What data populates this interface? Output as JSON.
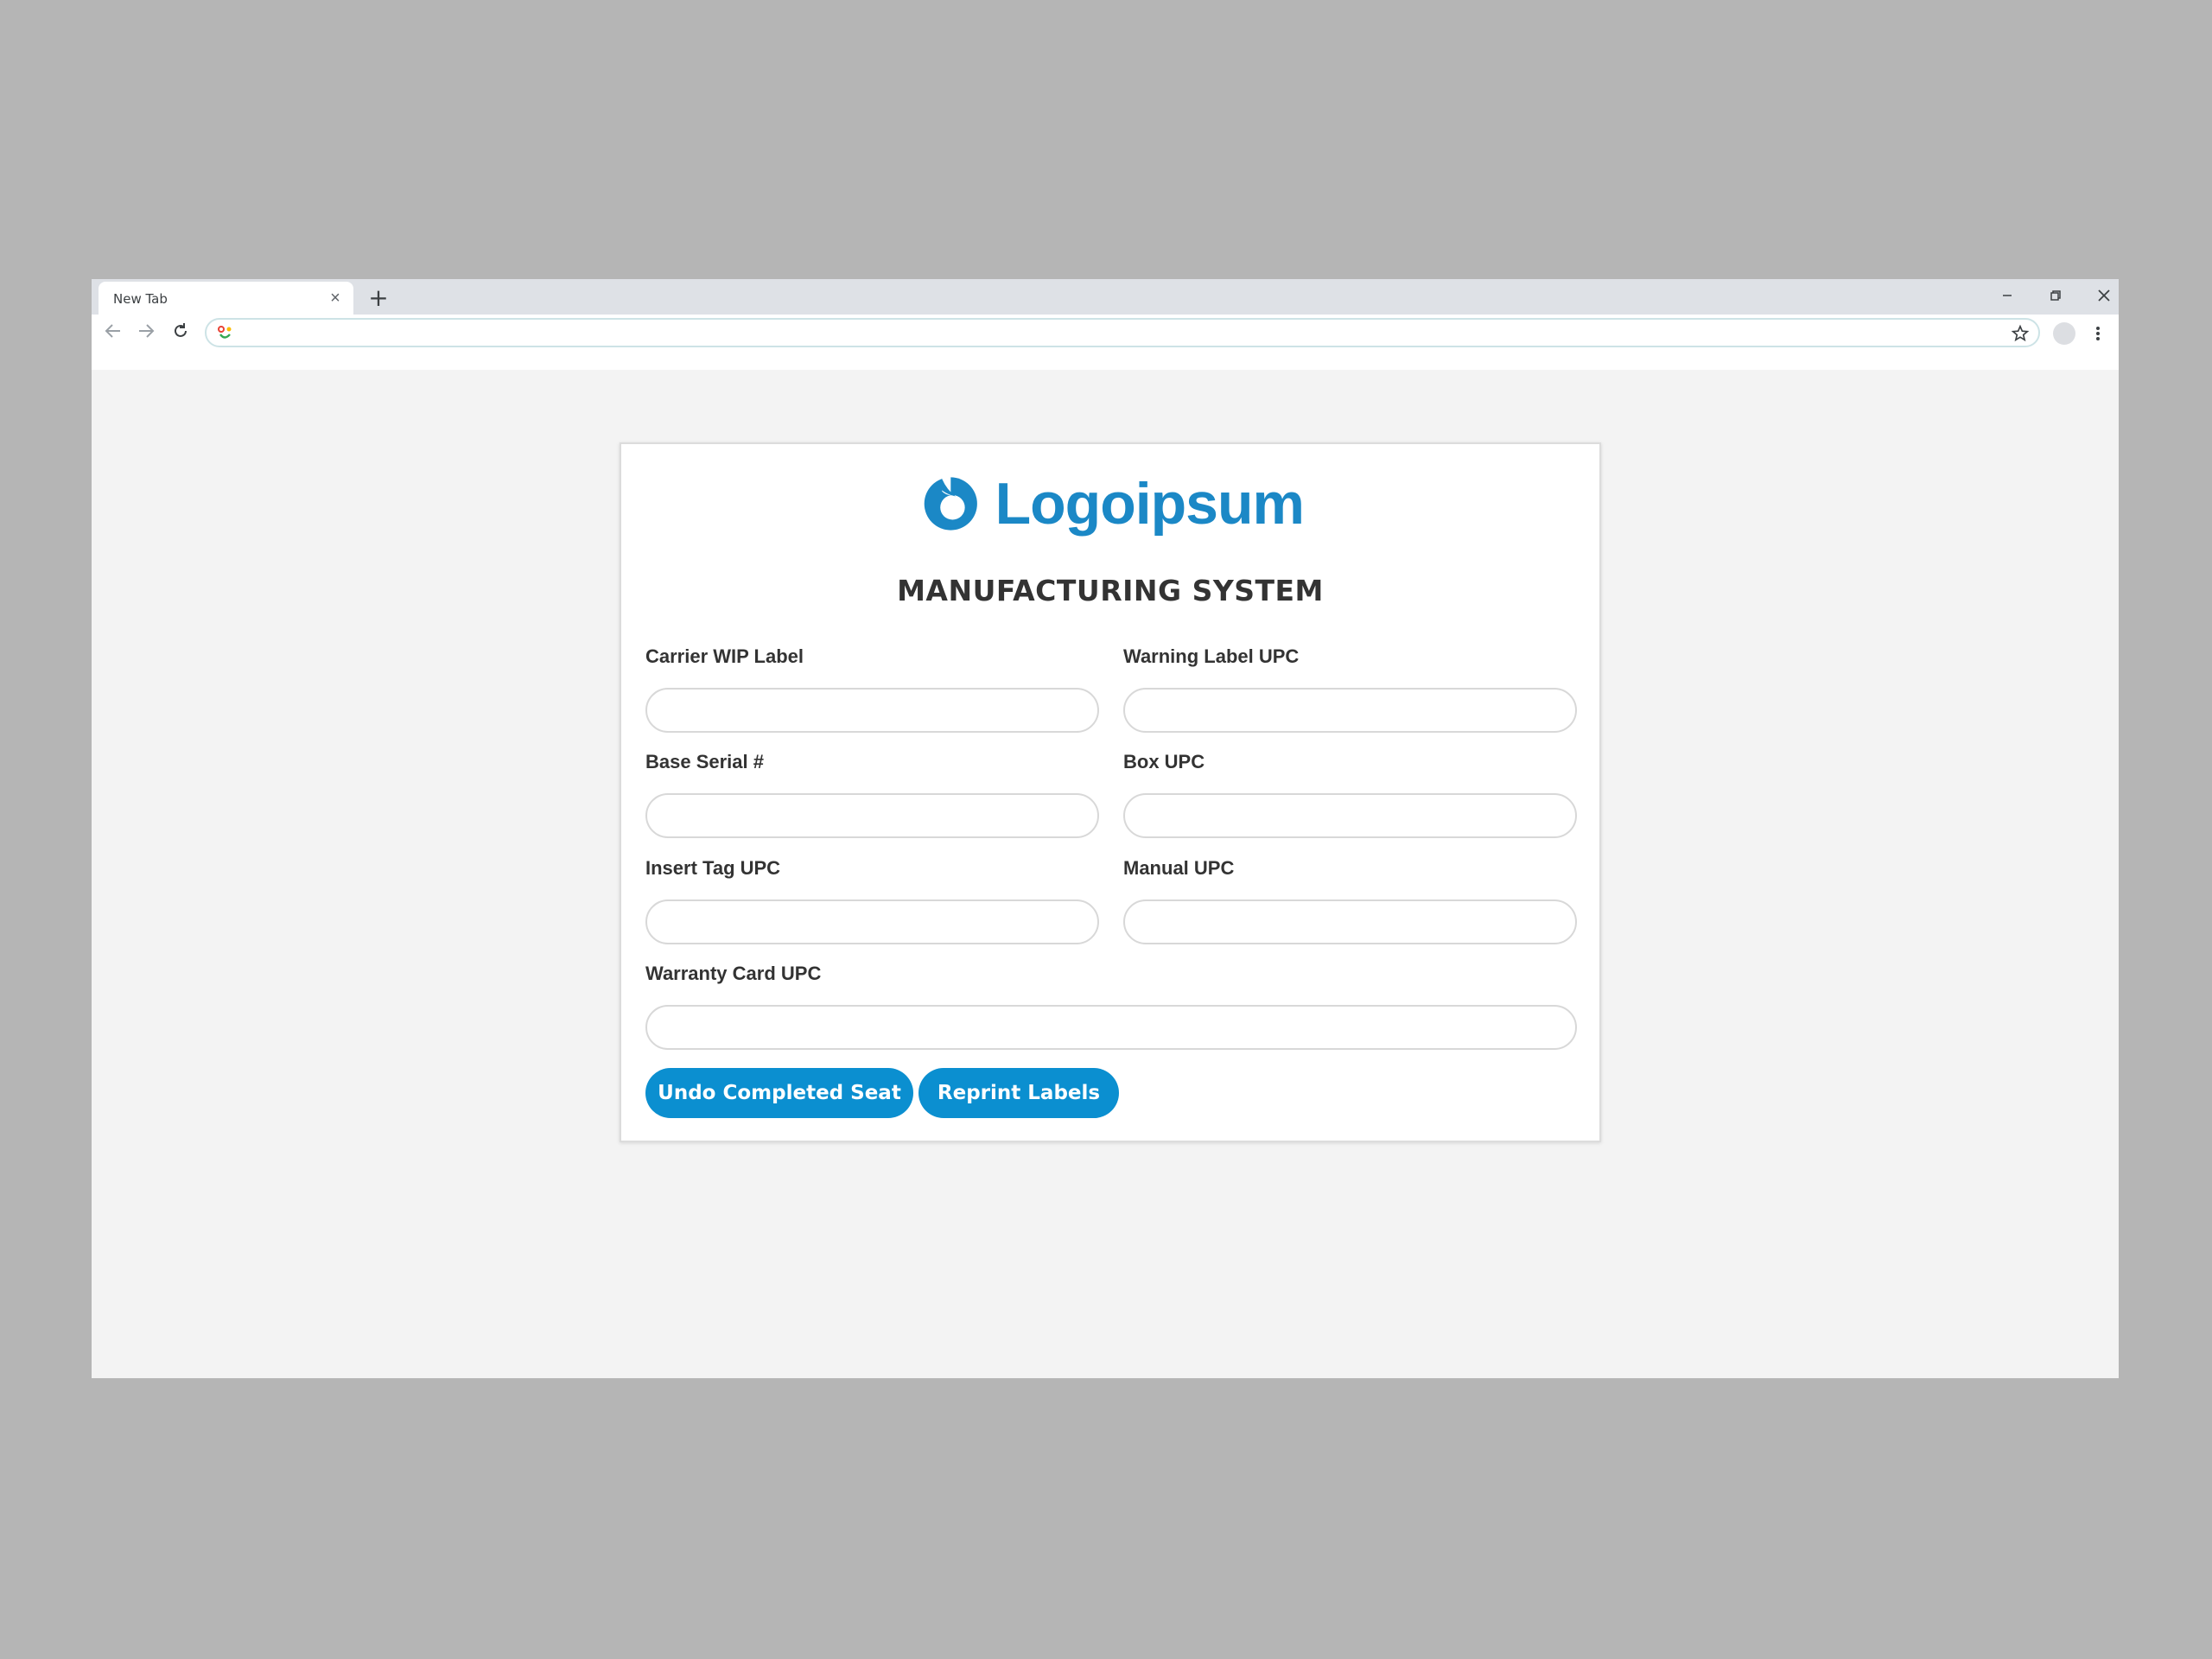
{
  "browser": {
    "tab_title": "New Tab",
    "tab_close_glyph": "×",
    "new_tab_glyph": "+",
    "address_value": "",
    "icons": {
      "back": "back-arrow-icon",
      "forward": "forward-arrow-icon",
      "reload": "reload-icon",
      "star": "bookmark-star-icon",
      "menu": "more-vert-icon",
      "minimize": "minimize-icon",
      "restore": "restore-icon",
      "close": "close-icon"
    }
  },
  "app": {
    "logo_text": "Logoipsum",
    "title": "MANUFACTURING SYSTEM",
    "brand_color": "#1b88c6",
    "button_color": "#0b8fd0"
  },
  "form": {
    "carrier_wip_label": {
      "label": "Carrier WIP Label",
      "value": ""
    },
    "warning_label_upc": {
      "label": "Warning Label UPC",
      "value": ""
    },
    "base_serial": {
      "label": "Base Serial #",
      "value": ""
    },
    "box_upc": {
      "label": "Box UPC",
      "value": ""
    },
    "insert_tag_upc": {
      "label": "Insert Tag UPC",
      "value": ""
    },
    "manual_upc": {
      "label": "Manual UPC",
      "value": ""
    },
    "warranty_card_upc": {
      "label": "Warranty Card UPC",
      "value": ""
    }
  },
  "actions": {
    "undo_label": "Undo Completed Seat",
    "reprint_label": "Reprint Labels"
  }
}
